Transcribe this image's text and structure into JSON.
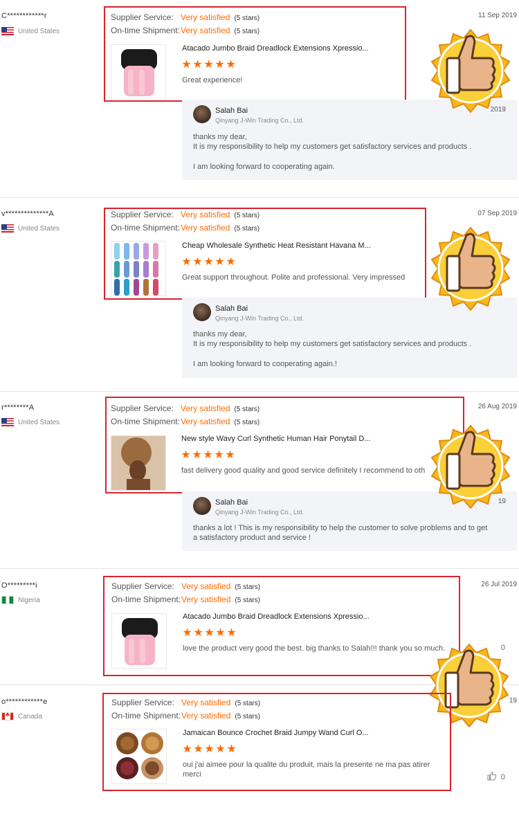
{
  "labels": {
    "supplier_service": "Supplier Service:",
    "ontime_shipment": "On-time Shipment:",
    "reply_name": "Salah Bai",
    "reply_company": "Qinyang J-Win Trading Co., Ltd."
  },
  "reviews": [
    {
      "buyer": "C************r",
      "country": "United States",
      "date": "11 Sep 2019",
      "service_rating": "Very satisfied",
      "service_stars": "(5 stars)",
      "shipment_rating": "Very satisfied",
      "shipment_stars": "(5 stars)",
      "product_title": "Atacado Jumbo Braid Dreadlock Extensions Xpressio...",
      "stars": 5,
      "comment": "Great experience!",
      "reply_date_fragment": "2019",
      "reply_lines": [
        "thanks my dear,",
        "It is my  responsibility to help my customers get satisfactory services and products .",
        "",
        "I am looking forward to cooperating again."
      ]
    },
    {
      "buyer": "v**************A",
      "country": "United States",
      "date": "07 Sep 2019",
      "service_rating": "Very satisfied",
      "service_stars": "(5 stars)",
      "shipment_rating": "Very satisfied",
      "shipment_stars": "(5 stars)",
      "product_title": "Cheap Wholesale Synthetic Heat Resistant Havana M...",
      "stars": 5,
      "comment": "Great support throughout. Polite and professional. Very impressed",
      "reply_lines": [
        "thanks my dear,",
        "It is my  responsibility to help my customers get satisfactory services and products .",
        "",
        "I am looking forward to cooperating again.!"
      ]
    },
    {
      "buyer": "r********A",
      "country": "United States",
      "date": "26 Aug 2019",
      "service_rating": "Very satisfied",
      "service_stars": "(5 stars)",
      "shipment_rating": "Very satisfied",
      "shipment_stars": "(5 stars)",
      "product_title": "New style Wavy Curl Synthetic Human Hair Ponytail D...",
      "stars": 5,
      "comment": "fast delivery good quality and good service definitely I recommend to oth",
      "reply_date_fragment": "19",
      "reply_lines": [
        "thanks a lot !    This is my responsibility to help the customer to solve problems and to get",
        "a satisfactory product and service !"
      ]
    },
    {
      "buyer": "O*********i",
      "country": "Nigeria",
      "date": "26 Jul 2019",
      "service_rating": "Very satisfied",
      "service_stars": "(5 stars)",
      "shipment_rating": "Very satisfied",
      "shipment_stars": "(5 stars)",
      "product_title": "Atacado Jumbo Braid Dreadlock Extensions Xpressio...",
      "stars": 5,
      "comment": "love the product very good the best. big thanks to Salah!!! thank you so much.",
      "likes": "0"
    },
    {
      "buyer": "o************e",
      "country": "Canada",
      "date_fragment": "19",
      "service_rating": "Very satisfied",
      "service_stars": "(5 stars)",
      "shipment_rating": "Very satisfied",
      "shipment_stars": "(5 stars)",
      "product_title": "Jamaican Bounce Crochet Braid Jumpy Wand Curl O...",
      "stars": 5,
      "comment_lines": [
        "oui j'ai aimee pour la qualite du produit,  mais la presente ne ma pas atirer",
        "merci"
      ],
      "likes": "0"
    }
  ],
  "icons": {
    "star": "star-icon",
    "thumbs_up_badge": "thumbs-up-badge-icon",
    "like": "like-icon"
  },
  "colors": {
    "accent": "#ff6a00",
    "highlight_frame": "#d9232d",
    "badge_gold": "#f6b81a"
  }
}
